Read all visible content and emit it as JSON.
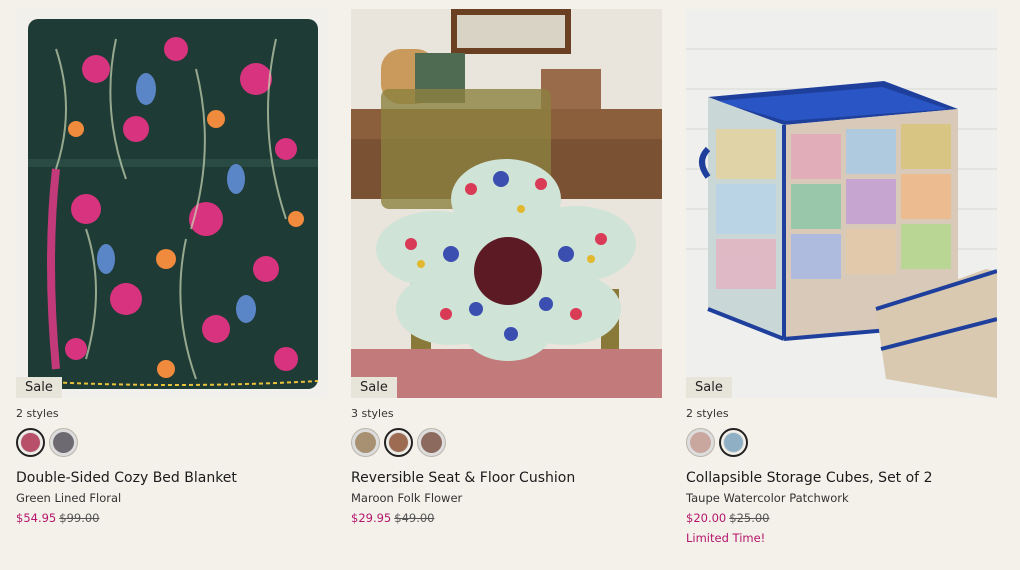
{
  "products": [
    {
      "badge": "Sale",
      "styles_count": "2 styles",
      "swatches": [
        {
          "name": "pink-floral",
          "selected": true,
          "color": "#b8506a"
        },
        {
          "name": "grey-floral",
          "selected": false,
          "color": "#6d6a72"
        }
      ],
      "name": "Double-Sided Cozy Bed Blanket",
      "variant": "Green Lined Floral",
      "sale_price": "$54.95",
      "original_price": "$99.00",
      "promo": ""
    },
    {
      "badge": "Sale",
      "styles_count": "3 styles",
      "swatches": [
        {
          "name": "tan-floral",
          "selected": false,
          "color": "#a89173"
        },
        {
          "name": "maroon-folk",
          "selected": true,
          "color": "#9d6b52"
        },
        {
          "name": "brown-floral",
          "selected": false,
          "color": "#8d6a5e"
        }
      ],
      "name": "Reversible Seat & Floor Cushion",
      "variant": "Maroon Folk Flower",
      "sale_price": "$29.95",
      "original_price": "$49.00",
      "promo": ""
    },
    {
      "badge": "Sale",
      "styles_count": "2 styles",
      "swatches": [
        {
          "name": "red-patchwork",
          "selected": false,
          "color": "#c9a79f"
        },
        {
          "name": "taupe-watercolor",
          "selected": true,
          "color": "#8fb0c4"
        }
      ],
      "name": "Collapsible Storage Cubes, Set of 2",
      "variant": "Taupe Watercolor Patchwork",
      "sale_price": "$20.00",
      "original_price": "$25.00",
      "promo": "Limited Time!"
    }
  ],
  "colors": {
    "sale_price": "#b5166c",
    "page_bg": "#f4f1ea",
    "badge_bg": "#e7e4da"
  }
}
